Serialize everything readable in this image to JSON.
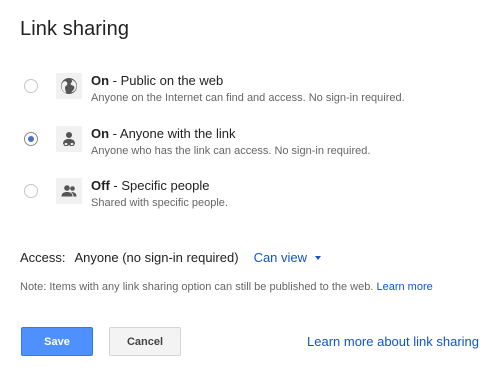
{
  "dialog": {
    "title": "Link sharing"
  },
  "options": [
    {
      "state": "On",
      "title_suffix": " - Public on the web",
      "description": "Anyone on the Internet can find and access. No sign-in required.",
      "icon": "globe-icon",
      "selected": false
    },
    {
      "state": "On",
      "title_suffix": " - Anyone with the link",
      "description": "Anyone who has the link can access. No sign-in required.",
      "icon": "link-person-icon",
      "selected": true
    },
    {
      "state": "Off",
      "title_suffix": " - Specific people",
      "description": "Shared with specific people.",
      "icon": "people-icon",
      "selected": false
    }
  ],
  "access": {
    "label": "Access:",
    "value": "Anyone (no sign-in required)",
    "permission": "Can view"
  },
  "note": {
    "text": "Note: Items with any link sharing option can still be published to the web. ",
    "link": "Learn more"
  },
  "buttons": {
    "save": "Save",
    "cancel": "Cancel"
  },
  "footer_link": "Learn more about link sharing",
  "colors": {
    "accent": "#4d90fe",
    "link": "#1155cc",
    "radio_selected": "#4b6fc4"
  }
}
